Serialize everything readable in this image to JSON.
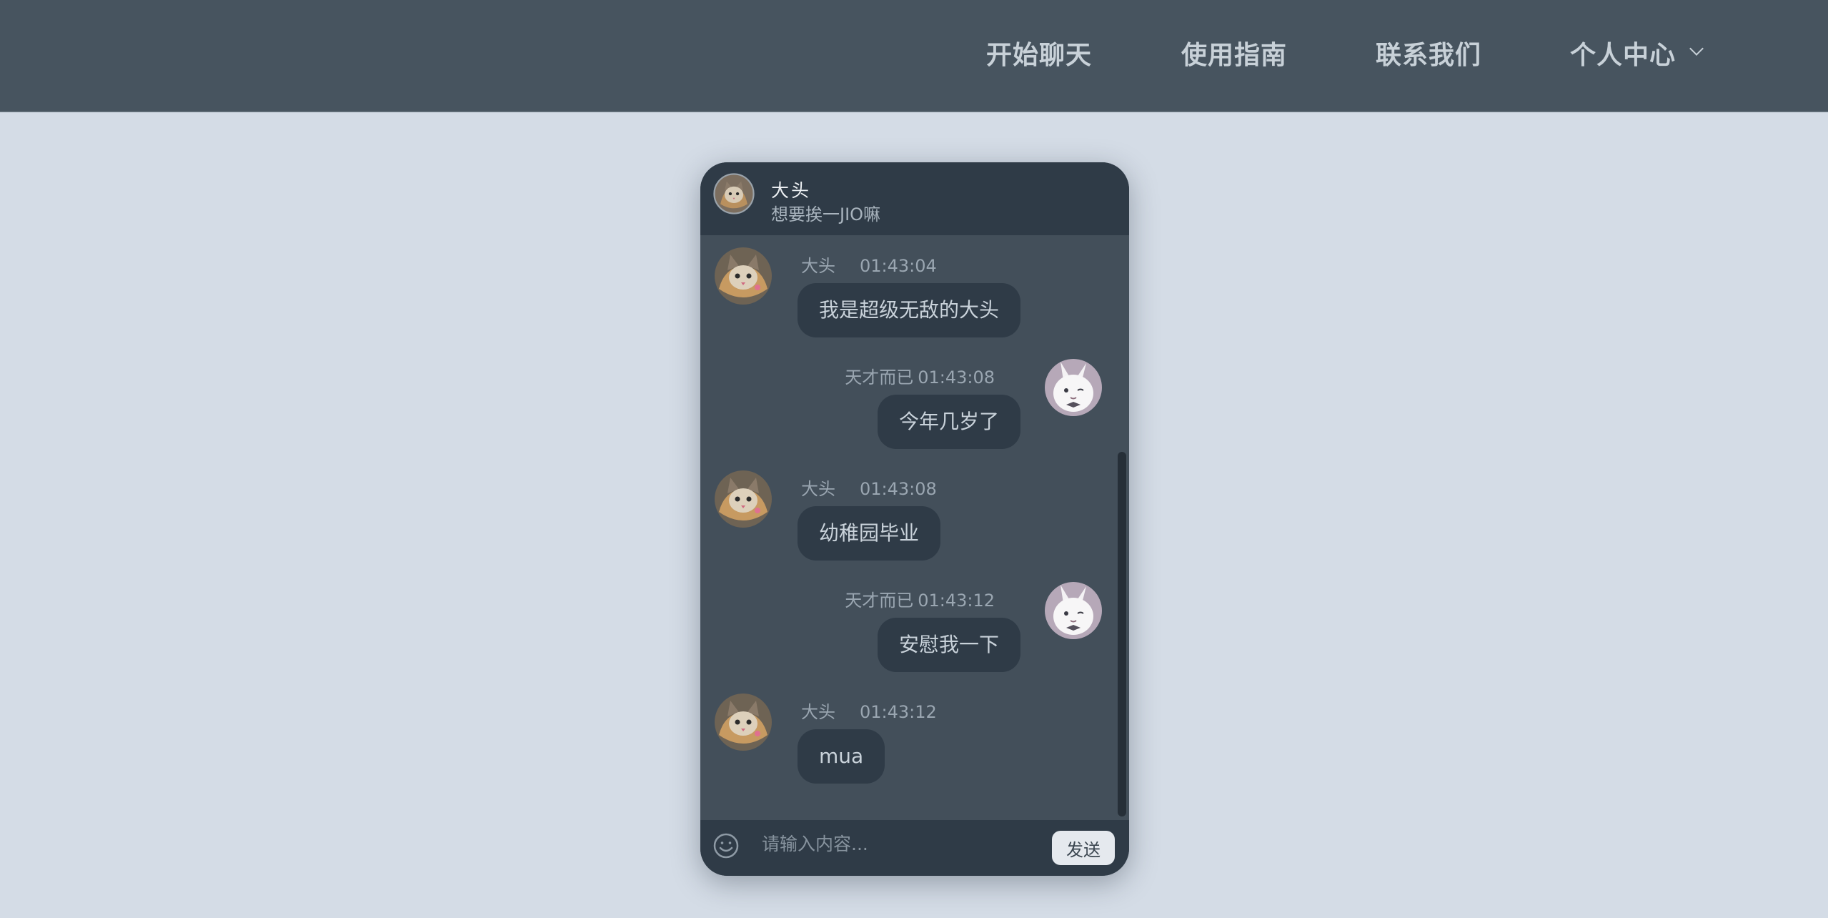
{
  "nav": {
    "items": [
      "开始聊天",
      "使用指南",
      "联系我们",
      "个人中心"
    ]
  },
  "chat": {
    "header": {
      "name": "大头",
      "status": "想要挨一JIO嘛"
    },
    "messages": [
      {
        "side": "left",
        "sender": "大头",
        "time": "01:43:04",
        "text": "我是超级无敌的大头",
        "avatar": "cat-avatar"
      },
      {
        "side": "right",
        "sender": "天才而已",
        "time": "01:43:08",
        "text": "今年几岁了",
        "avatar": "rabbit-avatar"
      },
      {
        "side": "left",
        "sender": "大头",
        "time": "01:43:08",
        "text": "幼稚园毕业",
        "avatar": "cat-avatar"
      },
      {
        "side": "right",
        "sender": "天才而已",
        "time": "01:43:12",
        "text": "安慰我一下",
        "avatar": "rabbit-avatar"
      },
      {
        "side": "left",
        "sender": "大头",
        "time": "01:43:12",
        "text": "mua",
        "avatar": "cat-avatar"
      }
    ],
    "composer": {
      "placeholder": "请输入内容...",
      "send_label": "发送",
      "emoji_icon": "smiley-icon"
    }
  },
  "colors": {
    "topbar": "#47545f",
    "page_bg": "#d4dce6",
    "chat_bg": "#434f5a",
    "bubble_bg": "#2f3b47",
    "send_button_bg": "#e5e9ee"
  }
}
